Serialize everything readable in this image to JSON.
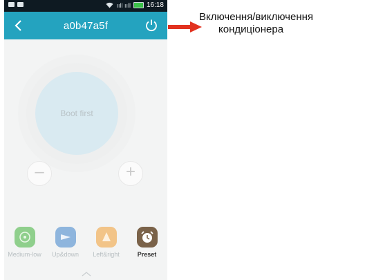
{
  "status_bar": {
    "time": "16:18",
    "signal": "ııll ııll"
  },
  "header": {
    "title": "a0b47a5f"
  },
  "dial": {
    "label": "Boot first",
    "minus": "–",
    "plus": "+"
  },
  "modes": [
    {
      "label": "Medium-low",
      "icon": "fan-speed-icon",
      "color": "#8fcf8c",
      "active": false
    },
    {
      "label": "Up&down",
      "icon": "swing-updown-icon",
      "color": "#8eb5dd",
      "active": false
    },
    {
      "label": "Left&right",
      "icon": "swing-leftright-icon",
      "color": "#f2c488",
      "active": false
    },
    {
      "label": "Preset",
      "icon": "alarm-clock-icon",
      "color": "#7a6249",
      "active": true
    }
  ],
  "annotation": {
    "line1": "Включення/виключення",
    "line2": "кондиціонера",
    "arrow_color": "#e2321f"
  },
  "colors": {
    "header": "#24a3bf",
    "statusbar": "#0e1a22"
  }
}
